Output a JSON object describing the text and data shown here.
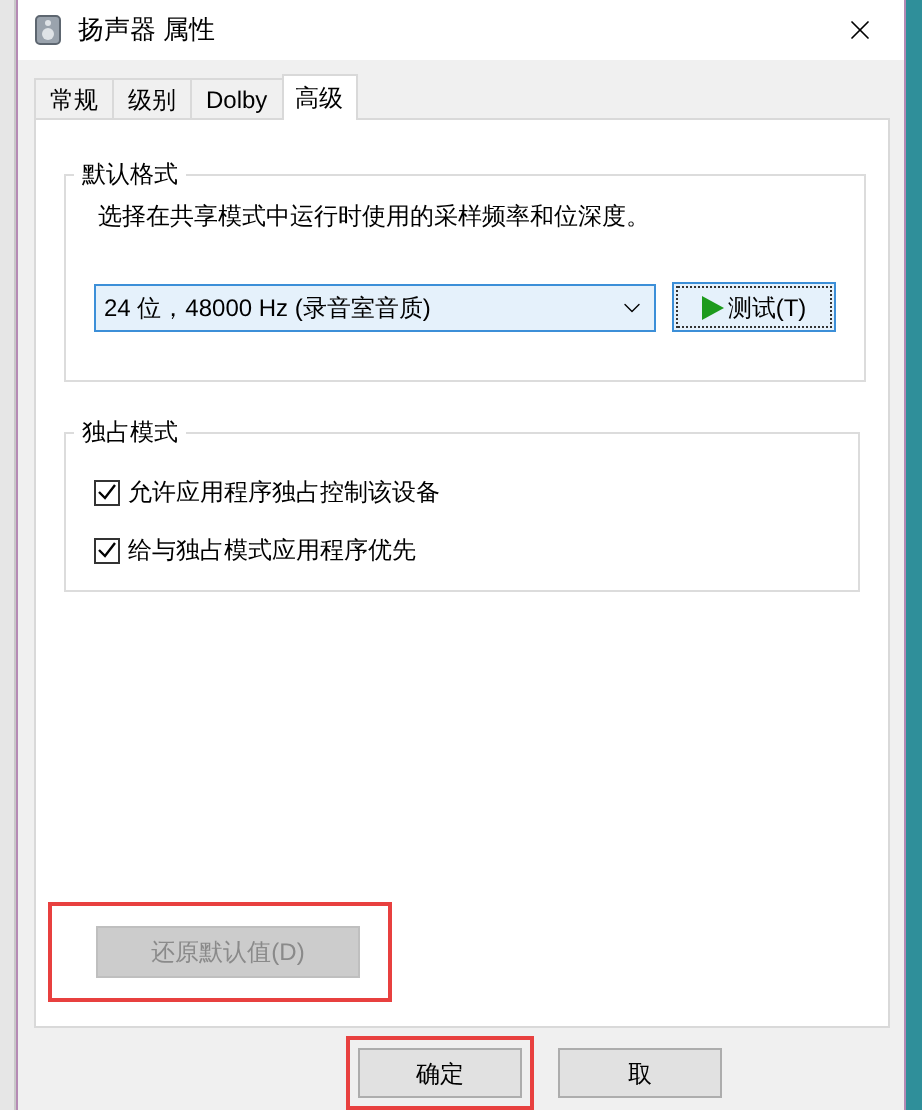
{
  "window": {
    "title": "扬声器 属性"
  },
  "tabs": [
    {
      "label": "常规",
      "selected": false
    },
    {
      "label": "级别",
      "selected": false
    },
    {
      "label": "Dolby",
      "selected": false
    },
    {
      "label": "高级",
      "selected": true
    }
  ],
  "default_format": {
    "title": "默认格式",
    "description": "选择在共享模式中运行时使用的采样频率和位深度。",
    "format_select": {
      "value": "24 位，48000 Hz (录音室音质)"
    },
    "test_button": {
      "label": "测试(T)"
    }
  },
  "exclusive_mode": {
    "title": "独占模式",
    "options": [
      {
        "label": "允许应用程序独占控制该设备",
        "checked": true
      },
      {
        "label": "给与独占模式应用程序优先",
        "checked": true
      }
    ]
  },
  "restore_button": {
    "label": "还原默认值(D)",
    "disabled": true,
    "highlighted": true
  },
  "buttons": [
    {
      "label": "确定",
      "highlighted": true
    },
    {
      "label": "取",
      "highlighted": false
    }
  ]
}
